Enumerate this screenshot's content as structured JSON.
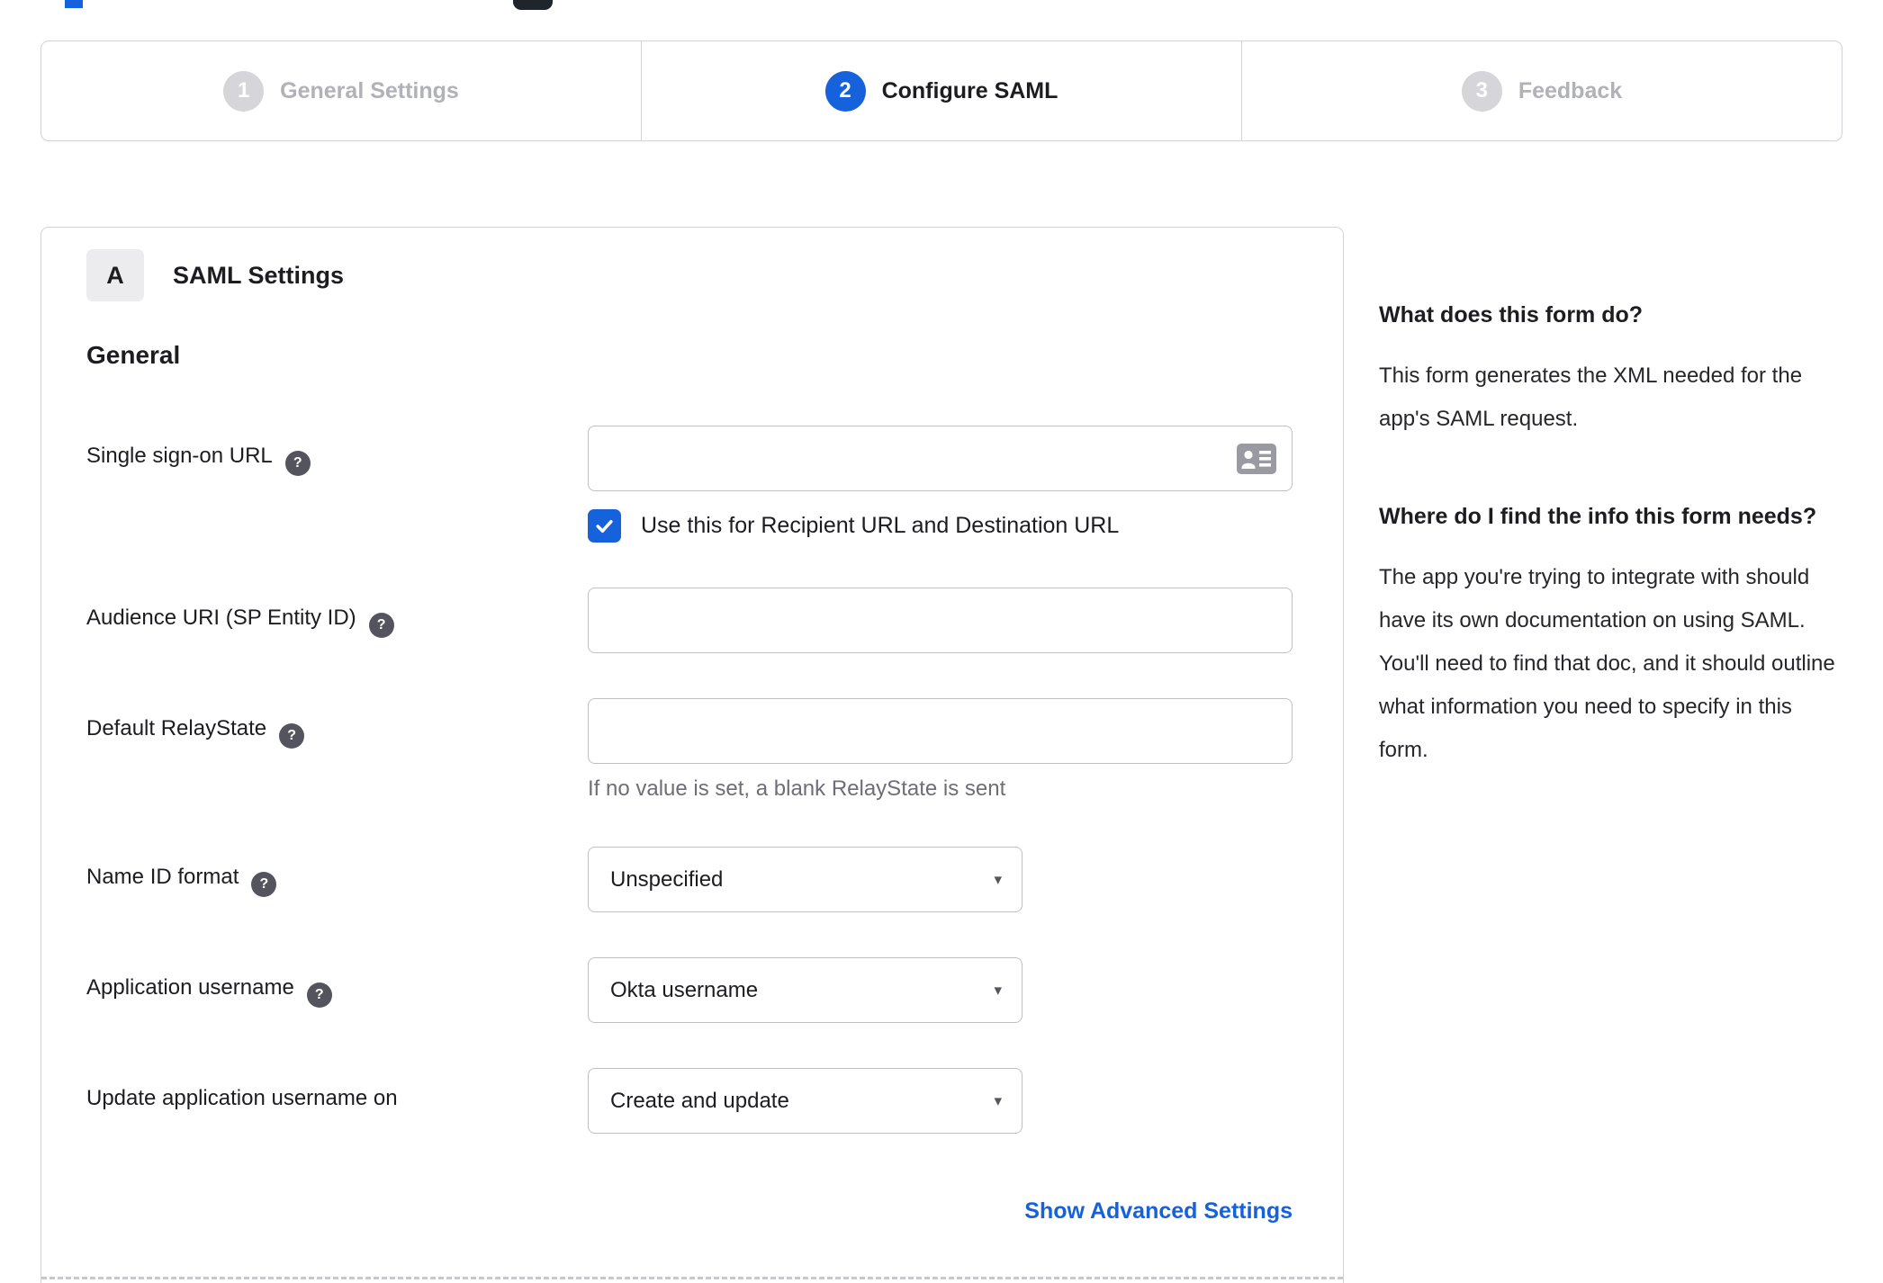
{
  "stepper": {
    "steps": [
      {
        "number": "1",
        "label": "General Settings",
        "state": "inactive"
      },
      {
        "number": "2",
        "label": "Configure SAML",
        "state": "active"
      },
      {
        "number": "3",
        "label": "Feedback",
        "state": "inactive"
      }
    ]
  },
  "panel": {
    "badge": "A",
    "title": "SAML Settings",
    "section_heading": "General",
    "fields": [
      {
        "label": "Single sign-on URL",
        "value": "",
        "checkbox_checked": true,
        "checkbox_label": "Use this for Recipient URL and Destination URL"
      },
      {
        "label": "Audience URI (SP Entity ID)",
        "value": ""
      },
      {
        "label": "Default RelayState",
        "value": "",
        "helper": "If no value is set, a blank RelayState is sent"
      },
      {
        "label": "Name ID format",
        "value": "Unspecified"
      },
      {
        "label": "Application username",
        "value": "Okta username"
      },
      {
        "label": "Update application username on",
        "value": "Create and update"
      }
    ],
    "advanced_link": "Show Advanced Settings"
  },
  "sidebar": {
    "sections": [
      {
        "heading": "What does this form do?",
        "body": "This form generates the XML needed for the app's SAML request."
      },
      {
        "heading": "Where do I find the info this form needs?",
        "body": "The app you're trying to integrate with should have its own documentation on using SAML. You'll need to find that doc, and it should outline what information you need to specify in this form."
      }
    ]
  },
  "icons": {
    "help": "?",
    "caret": "▾"
  },
  "colors": {
    "accent_blue": "#1662dd",
    "inactive_gray": "#d6d6da",
    "text_dark": "#1d1d21",
    "muted_gray": "#6e6e78",
    "border_gray": "#d4d4d8",
    "link_blue": "#1662dd"
  }
}
